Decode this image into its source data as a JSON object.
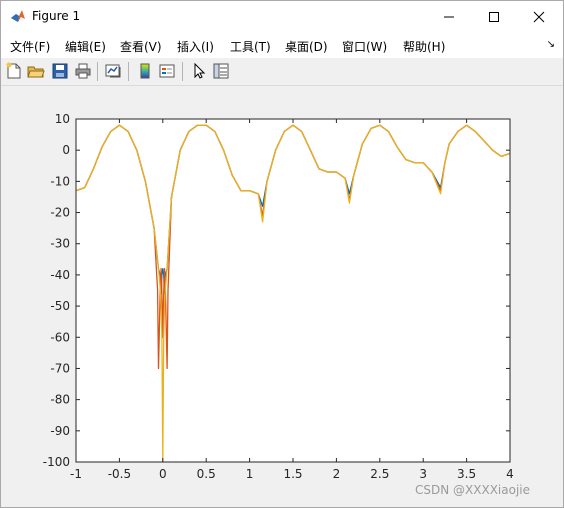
{
  "window": {
    "title": "Figure 1",
    "minimize_glyph": "—",
    "maximize_glyph": "☐",
    "close_glyph": "✕"
  },
  "menu": {
    "items": [
      {
        "id": "file",
        "label": "文件(F)"
      },
      {
        "id": "edit",
        "label": "编辑(E)"
      },
      {
        "id": "view",
        "label": "查看(V)"
      },
      {
        "id": "insert",
        "label": "插入(I)"
      },
      {
        "id": "tools",
        "label": "工具(T)"
      },
      {
        "id": "desktop",
        "label": "桌面(D)"
      },
      {
        "id": "window",
        "label": "窗口(W)"
      },
      {
        "id": "help",
        "label": "帮助(H)"
      }
    ],
    "overflow_glyph": "↘"
  },
  "toolbar": {
    "icons": [
      "new-figure-icon",
      "open-file-icon",
      "save-icon",
      "print-icon",
      "link-plot-icon",
      "colorbar-icon",
      "legend-icon",
      "pointer-icon",
      "property-editor-icon"
    ]
  },
  "watermark": "CSDN @XXXXiaojie",
  "chart_data": {
    "type": "line",
    "title": "",
    "xlabel": "",
    "ylabel": "",
    "xlim": [
      -1,
      4
    ],
    "ylim": [
      -100,
      10
    ],
    "xticks": [
      "-1",
      "-0.5",
      "0",
      "0.5",
      "1",
      "1.5",
      "2",
      "2.5",
      "3",
      "3.5",
      "4"
    ],
    "yticks": [
      "10",
      "0",
      "-10",
      "-20",
      "-30",
      "-40",
      "-50",
      "-60",
      "-70",
      "-80",
      "-90",
      "-100"
    ],
    "grid": false,
    "legend": "none",
    "series": [
      {
        "color": "#0072bd",
        "x": [
          -1,
          -0.9,
          -0.8,
          -0.7,
          -0.6,
          -0.5,
          -0.4,
          -0.3,
          -0.2,
          -0.1,
          -0.05,
          -0.03,
          -0.02,
          -0.01,
          0,
          0.01,
          0.02,
          0.03,
          0.05,
          0.1,
          0.2,
          0.3,
          0.4,
          0.5,
          0.6,
          0.7,
          0.8,
          0.9,
          1.0,
          1.1,
          1.15,
          1.2,
          1.3,
          1.4,
          1.5,
          1.6,
          1.7,
          1.8,
          1.9,
          2.0,
          2.1,
          2.15,
          2.2,
          2.3,
          2.4,
          2.5,
          2.6,
          2.7,
          2.8,
          2.9,
          3.0,
          3.1,
          3.2,
          3.25,
          3.3,
          3.4,
          3.5,
          3.6,
          3.7,
          3.8,
          3.9,
          4.0
        ],
        "y": [
          -13,
          -12,
          -6,
          1,
          6,
          8,
          6,
          0,
          -10,
          -25,
          -38,
          -40,
          -46,
          -40,
          -38,
          -40,
          -46,
          -40,
          -38,
          -15,
          0,
          6,
          8,
          8,
          6,
          0,
          -8,
          -13,
          -13,
          -14,
          -18,
          -10,
          0,
          6,
          8,
          6,
          0,
          -6,
          -7,
          -7,
          -9,
          -14,
          -8,
          2,
          7,
          8,
          6,
          1,
          -3,
          -4,
          -4,
          -7,
          -12,
          -4,
          2,
          6,
          8,
          6,
          3,
          0,
          -2,
          -1
        ]
      },
      {
        "color": "#d95319",
        "x": [
          -1,
          -0.9,
          -0.8,
          -0.7,
          -0.6,
          -0.5,
          -0.4,
          -0.3,
          -0.2,
          -0.1,
          -0.06,
          -0.05,
          -0.03,
          -0.02,
          -0.01,
          0,
          0.01,
          0.02,
          0.03,
          0.05,
          0.06,
          0.1,
          0.2,
          0.3,
          0.4,
          0.5,
          0.6,
          0.7,
          0.8,
          0.9,
          1.0,
          1.1,
          1.15,
          1.2,
          1.3,
          1.4,
          1.5,
          1.6,
          1.7,
          1.8,
          1.9,
          2.0,
          2.1,
          2.15,
          2.2,
          2.3,
          2.4,
          2.5,
          2.6,
          2.7,
          2.8,
          2.9,
          3.0,
          3.1,
          3.2,
          3.25,
          3.3,
          3.4,
          3.5,
          3.6,
          3.7,
          3.8,
          3.9,
          4.0
        ],
        "y": [
          -13,
          -12,
          -6,
          1,
          6,
          8,
          6,
          0,
          -10,
          -25,
          -45,
          -70,
          -45,
          -38,
          -46,
          -60,
          -46,
          -38,
          -45,
          -70,
          -45,
          -15,
          0,
          6,
          8,
          8,
          6,
          0,
          -8,
          -13,
          -13,
          -14,
          -21,
          -10,
          0,
          6,
          8,
          6,
          0,
          -6,
          -7,
          -7,
          -9,
          -16,
          -8,
          2,
          7,
          8,
          6,
          1,
          -3,
          -4,
          -4,
          -7,
          -13,
          -4,
          2,
          6,
          8,
          6,
          3,
          0,
          -2,
          -1
        ]
      },
      {
        "color": "#edb120",
        "x": [
          -1,
          -0.9,
          -0.8,
          -0.7,
          -0.6,
          -0.5,
          -0.4,
          -0.3,
          -0.2,
          -0.1,
          -0.05,
          -0.03,
          -0.02,
          -0.01,
          0,
          0.01,
          0.02,
          0.03,
          0.05,
          0.1,
          0.2,
          0.3,
          0.4,
          0.5,
          0.6,
          0.7,
          0.8,
          0.9,
          1.0,
          1.1,
          1.15,
          1.2,
          1.3,
          1.4,
          1.5,
          1.6,
          1.7,
          1.8,
          1.9,
          2.0,
          2.1,
          2.15,
          2.2,
          2.3,
          2.4,
          2.5,
          2.6,
          2.7,
          2.8,
          2.9,
          3.0,
          3.1,
          3.2,
          3.25,
          3.3,
          3.4,
          3.5,
          3.6,
          3.7,
          3.8,
          3.9,
          4.0
        ],
        "y": [
          -13,
          -12,
          -6,
          1,
          6,
          8,
          6,
          0,
          -10,
          -25,
          -38,
          -44,
          -50,
          -60,
          -100,
          -60,
          -50,
          -44,
          -38,
          -15,
          0,
          6,
          8,
          8,
          6,
          0,
          -8,
          -13,
          -13,
          -14,
          -23,
          -10,
          0,
          6,
          8,
          6,
          0,
          -6,
          -7,
          -7,
          -9,
          -17,
          -8,
          2,
          7,
          8,
          6,
          1,
          -3,
          -4,
          -4,
          -7,
          -14,
          -4,
          2,
          6,
          8,
          6,
          3,
          0,
          -2,
          -1
        ]
      }
    ]
  }
}
